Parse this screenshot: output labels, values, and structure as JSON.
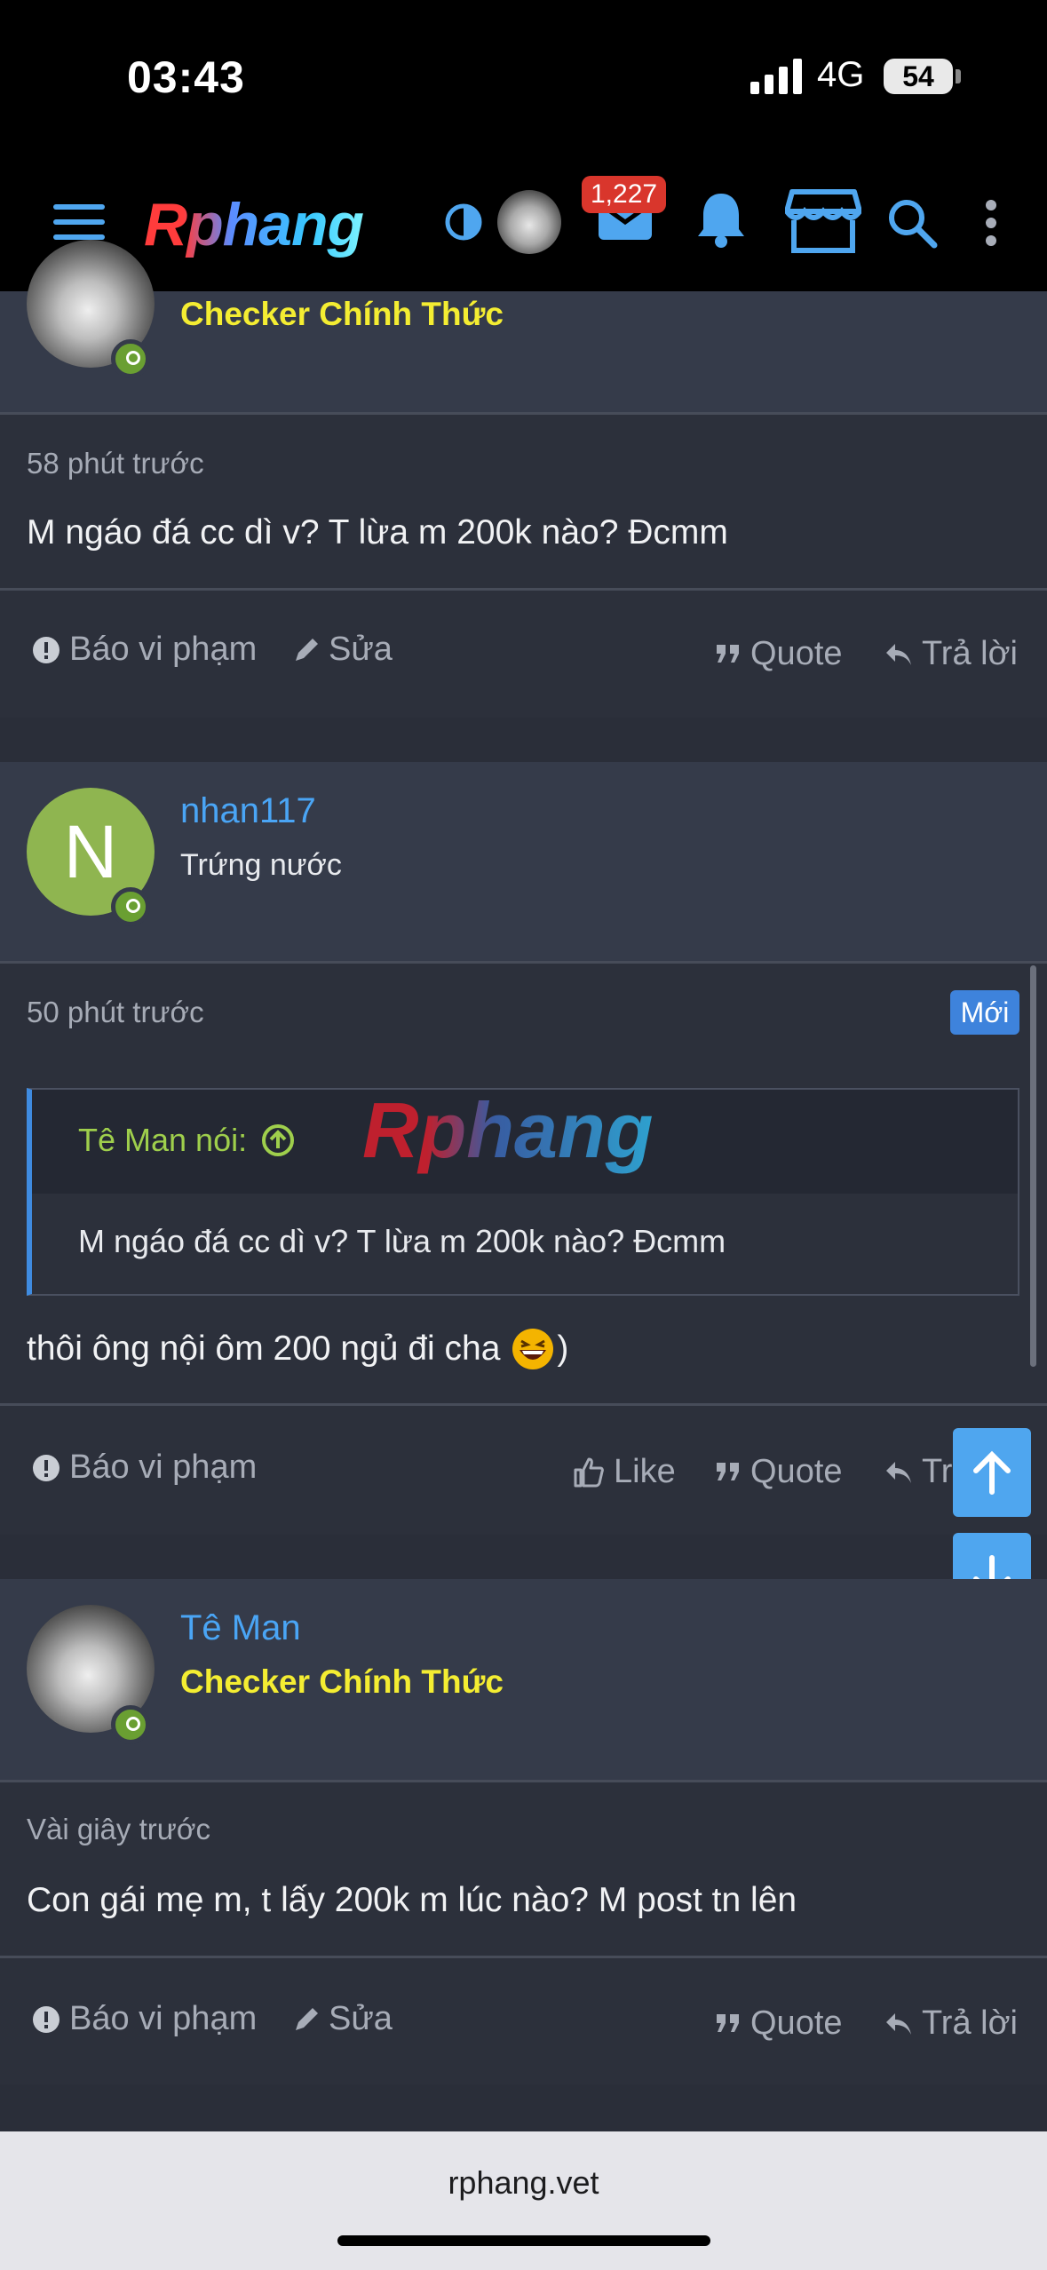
{
  "status": {
    "time": "03:43",
    "network": "4G",
    "battery": "54"
  },
  "nav": {
    "logo": "Rphang",
    "messages_badge": "1,227"
  },
  "posts": [
    {
      "user_title": "Checker Chính Thức",
      "time": "58 phút trước",
      "message": "M ngáo đá cc dì v? T lừa m 200k nào? Đcmm",
      "actions": {
        "report": "Báo vi phạm",
        "edit": "Sửa",
        "quote": "Quote",
        "reply": "Trả lời"
      }
    },
    {
      "avatar_letter": "N",
      "username": "nhan117",
      "user_title": "Trứng nước",
      "time": "50 phút trước",
      "new_label": "Mới",
      "quote_author": "Tê Man nói:",
      "quote_text": "M ngáo đá cc dì v? T lừa m 200k nào? Đcmm",
      "watermark": "Rphang",
      "message": "thôi ông nội ôm 200 ngủ đi cha",
      "message_tail": ")",
      "actions": {
        "report": "Báo vi phạm",
        "like": "Like",
        "quote": "Quote",
        "reply": "Tr"
      }
    },
    {
      "username": "Tê Man",
      "user_title": "Checker Chính Thức",
      "time": "Vài giây trước",
      "message": "Con gái mẹ m, t lấy 200k m lúc nào? M post tn lên",
      "actions": {
        "report": "Báo vi phạm",
        "edit": "Sửa",
        "quote": "Quote",
        "reply": "Trả lời"
      }
    }
  ],
  "browser": {
    "url": "rphang.vet"
  }
}
